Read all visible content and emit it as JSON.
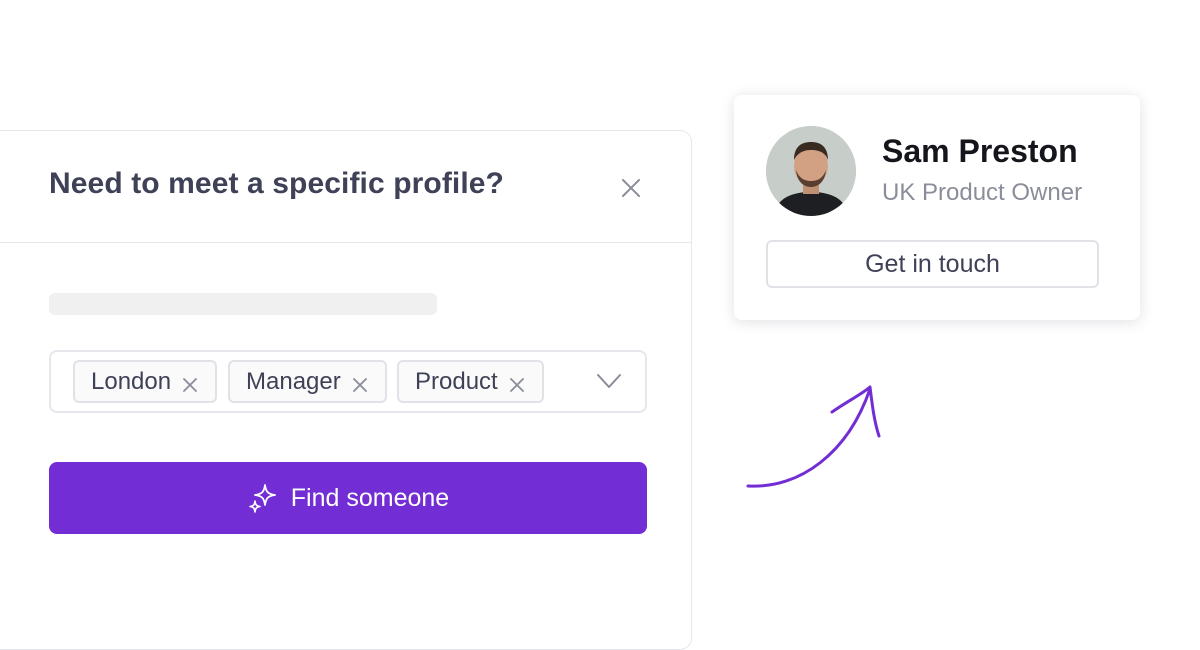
{
  "panel": {
    "title": "Need to meet a specific profile?",
    "tags": [
      {
        "label": "London"
      },
      {
        "label": "Manager"
      },
      {
        "label": "Product"
      }
    ],
    "find_button_label": "Find someone"
  },
  "profile_card": {
    "name": "Sam Preston",
    "role": "UK Product Owner",
    "action_label": "Get in touch"
  },
  "colors": {
    "accent": "#732dd4",
    "text_primary": "#3f4157",
    "text_secondary": "#8b8d99",
    "border": "#e6e7ec"
  },
  "icons": {
    "close": "close-icon",
    "chip_remove": "remove-tag-icon",
    "dropdown": "chevron-down-icon",
    "find": "sparkle-icon",
    "arrow": "curved-arrow-icon"
  }
}
